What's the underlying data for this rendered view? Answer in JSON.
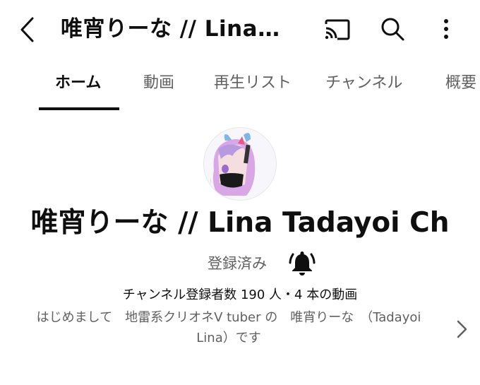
{
  "header": {
    "title": "唯宵りーな // Lina…",
    "icons": [
      "back-arrow-icon",
      "cast-icon",
      "search-icon",
      "more-vert-icon"
    ]
  },
  "tabs": [
    {
      "label": "ホーム",
      "active": true
    },
    {
      "label": "動画"
    },
    {
      "label": "再生リスト"
    },
    {
      "label": "チャンネル"
    },
    {
      "label": "概要"
    }
  ],
  "channel": {
    "name": "唯宵りーな // Lina Tadayoi Ch",
    "subscribe_label": "登録済み",
    "stats": "チャンネル登録者数 190 人・4 本の動画",
    "description_line1": "はじめまして　地雷系クリオネV tuber の　唯宵りーな　（Tadayoi",
    "description_line2": "Lina）です"
  },
  "colors": {
    "text_primary": "#0f0f0f",
    "text_secondary": "#606060",
    "avatar_hair": "#d9a6e6"
  }
}
